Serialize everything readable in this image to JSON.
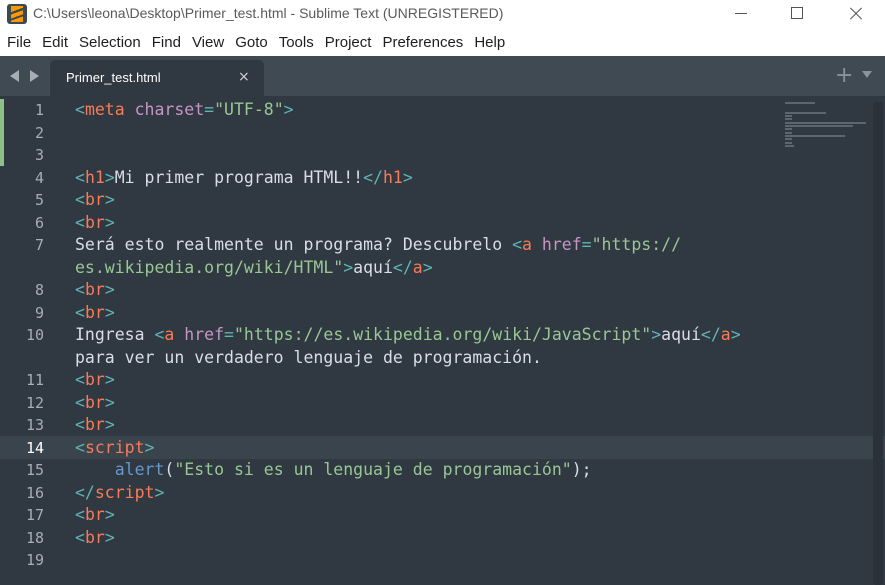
{
  "window": {
    "title": "C:\\Users\\leona\\Desktop\\Primer_test.html - Sublime Text (UNREGISTERED)"
  },
  "menu": [
    "File",
    "Edit",
    "Selection",
    "Find",
    "View",
    "Goto",
    "Tools",
    "Project",
    "Preferences",
    "Help"
  ],
  "tab": {
    "label": "Primer_test.html",
    "close_glyph": "×",
    "new_glyph": "+"
  },
  "editor": {
    "current_line": 14,
    "line_numbers": [
      "1",
      "2",
      "3",
      "4",
      "5",
      "6",
      "7",
      "",
      "8",
      "9",
      "10",
      "",
      "11",
      "12",
      "13",
      "14",
      "15",
      "16",
      "17",
      "18",
      "19"
    ],
    "lines": {
      "l1_tag": "meta",
      "l1_attr": "charset",
      "l1_val": "\"UTF-8\"",
      "l4_tag": "h1",
      "l4_text": "Mi primer programa HTML!!",
      "br": "br",
      "l7_text": "Será esto realmente un programa? Descubrelo ",
      "a": "a",
      "href": "href",
      "l7_url1": "\"https://",
      "l7_url2": "es.wikipedia.org/wiki/HTML\"",
      "aqui": "aquí",
      "l10_text": "Ingresa ",
      "l10_url": "\"https://es.wikipedia.org/wiki/JavaScript\"",
      "l10_cont": "para ver un verdadero lenguaje de programación.",
      "script": "script",
      "alert_fn": "alert",
      "alert_str": "\"Esto si es un lenguaje de programación\""
    }
  },
  "colors": {
    "background": "#303841",
    "tag": "#f97b58",
    "punctuation": "#5fb4b4",
    "attribute": "#c695c6",
    "string": "#99c794",
    "function": "#6699cc",
    "text": "#d8dee9"
  }
}
